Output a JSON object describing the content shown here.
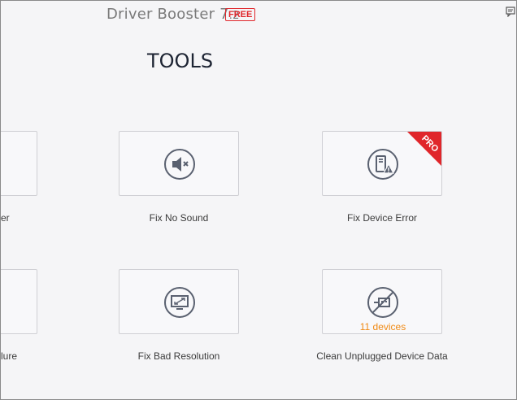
{
  "app": {
    "name": "Driver Booster 7",
    "version": ".2",
    "badge": "FREE"
  },
  "page": {
    "title": "TOOLS"
  },
  "tools": {
    "partial_top": {
      "label": "er"
    },
    "fix_no_sound": {
      "label": "Fix No Sound",
      "icon": "muted-speaker-icon"
    },
    "fix_device_error": {
      "label": "Fix Device Error",
      "icon": "device-warning-icon",
      "ribbon": "PRO"
    },
    "partial_bottom": {
      "label": "lure"
    },
    "fix_bad_resolution": {
      "label": "Fix Bad Resolution",
      "icon": "monitor-resize-icon"
    },
    "clean_unplugged": {
      "label": "Clean Unplugged Device Data",
      "icon": "unplugged-device-icon",
      "count": "11 devices"
    }
  },
  "colors": {
    "accent_red": "#e0262b",
    "count_orange": "#f08a14",
    "icon_gray": "#5a6170"
  }
}
